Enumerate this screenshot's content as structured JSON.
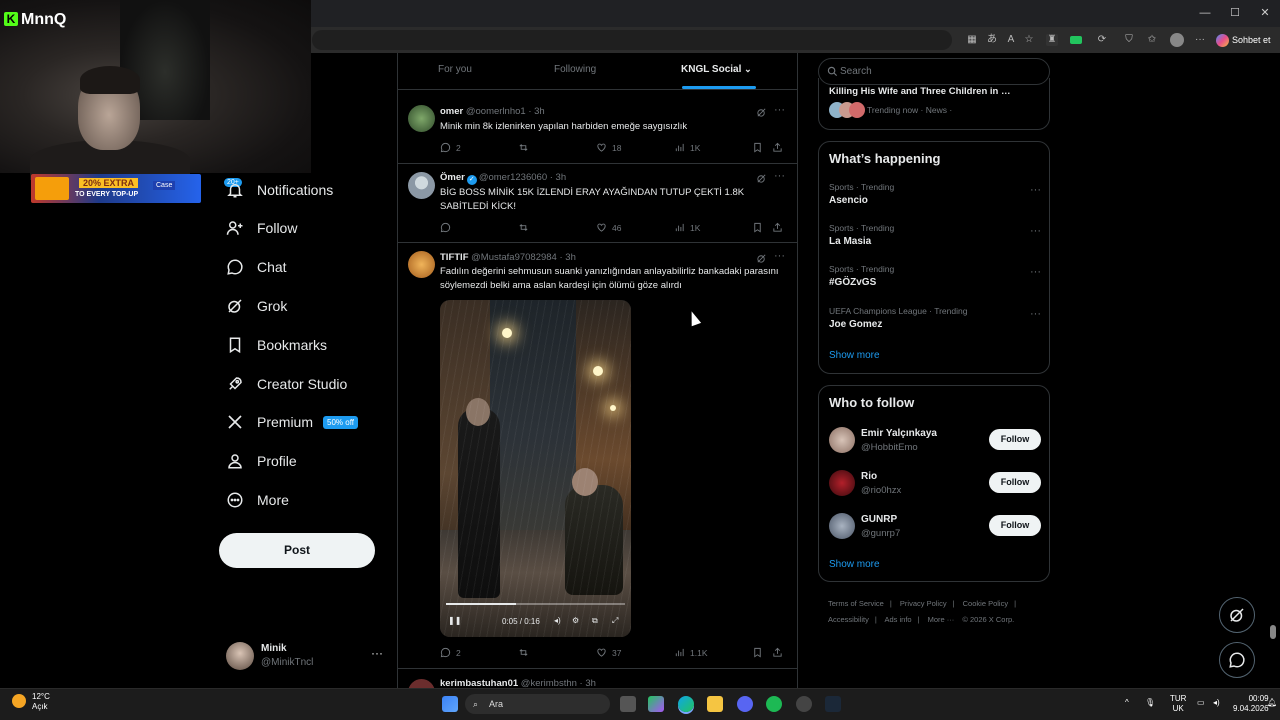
{
  "stream": {
    "brand": "MnnQ",
    "promo_extra": "20% EXTRA",
    "promo_sub": "TO EVERY TOP-UP",
    "promo_brand": "Case",
    "badge": "20+"
  },
  "browser": {
    "chat_label": "Sohbet et",
    "window_controls": [
      "—",
      "☐",
      "✕"
    ]
  },
  "nav": {
    "items": [
      {
        "label": "Notifications",
        "icon": "bell-icon"
      },
      {
        "label": "Follow",
        "icon": "person-plus-icon"
      },
      {
        "label": "Chat",
        "icon": "chat-icon"
      },
      {
        "label": "Grok",
        "icon": "grok-icon"
      },
      {
        "label": "Bookmarks",
        "icon": "bookmark-icon"
      },
      {
        "label": "Creator Studio",
        "icon": "rocket-icon"
      },
      {
        "label": "Premium",
        "icon": "x-logo-icon"
      },
      {
        "label": "Profile",
        "icon": "person-icon"
      },
      {
        "label": "More",
        "icon": "more-circle-icon"
      }
    ],
    "premium_badge": "50% off",
    "post_label": "Post",
    "account": {
      "name": "Minik",
      "handle": "@MinikTncl"
    }
  },
  "feed": {
    "tabs": [
      "For you",
      "Following",
      "KNGL Social"
    ],
    "active_tab": 2,
    "tweets": [
      {
        "name": "omer",
        "handle": "@oomerlnho1",
        "time": "· 3h",
        "text": "Minik min 8k izlenirken yapılan harbiden emeğe saygısızlık",
        "replies": "2",
        "reposts": "",
        "likes": "18",
        "views": "1K"
      },
      {
        "name": "Ömer",
        "handle": "@omer1236060",
        "time": "· 3h",
        "verified": true,
        "text": "BİG BOSS MİNİK 15K İZLENDİ ERAY AYAĞINDAN TUTUP ÇEKTİ 1.8K SABİTLEDİ KİCK!",
        "replies": "",
        "reposts": "",
        "likes": "46",
        "views": "1K"
      },
      {
        "name": "TIFTIF",
        "handle": "@Mustafa97082984",
        "time": "· 3h",
        "text": "Fadılın değerini sehmusun suanki yanızlığından anlayabilirliz bankadaki parasını söylemezdi belki ama aslan kardeşi için ölümü göze alırdı",
        "replies": "2",
        "reposts": "",
        "likes": "37",
        "views": "1.1K",
        "video_time": "0:05 / 0:16"
      },
      {
        "name": "kerimbastuhan01",
        "handle": "@kerimbsthn",
        "time": "· 3h"
      }
    ]
  },
  "sidebar": {
    "search_placeholder": "Search",
    "top_trend": {
      "title": "Killing His Wife and Three Children in …",
      "meta": "Trending now · News ·"
    },
    "happening_title": "What’s happening",
    "trends": [
      {
        "category": "Sports · Trending",
        "name": "Asencio"
      },
      {
        "category": "Sports · Trending",
        "name": "La Masia"
      },
      {
        "category": "Sports · Trending",
        "name": "#GÖZvGS"
      },
      {
        "category": "UEFA Champions League · Trending",
        "name": "Joe Gomez"
      }
    ],
    "show_more": "Show more",
    "wtf_title": "Who to follow",
    "follow_label": "Follow",
    "who_to_follow": [
      {
        "name": "Emir Yalçınkaya",
        "handle": "@HobbitEmo"
      },
      {
        "name": "Rio",
        "handle": "@rio0hzx"
      },
      {
        "name": "GUNRP",
        "handle": "@gunrp7"
      }
    ],
    "footer": [
      "Terms of Service",
      "|",
      "Privacy Policy",
      "|",
      "Cookie Policy",
      "|",
      "Accessibility",
      "|",
      "Ads info",
      "|",
      "More ···",
      "© 2026 X Corp."
    ]
  },
  "taskbar": {
    "temp": "12°C",
    "weather": "Açık",
    "search_label": "Ara",
    "lang1": "TUR",
    "lang2": "UK",
    "time": "00:09",
    "date": "9.04.2026"
  },
  "colors": {
    "accent": "#1d9bf0",
    "bg": "#000000",
    "border": "#2f3336",
    "muted": "#71767b"
  }
}
